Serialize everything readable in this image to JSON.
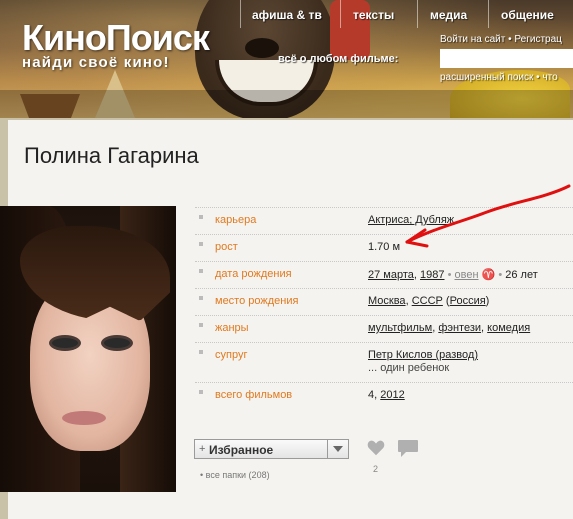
{
  "header": {
    "logo": "КиноПоиск",
    "tagline": "найди своё кино!",
    "nav": [
      "афиша & тв",
      "тексты",
      "медиа",
      "общение"
    ],
    "login_link": "Войти на сайт",
    "register_link": "Регистрац",
    "search_label": "всё о любом фильме:",
    "search_value": "",
    "advanced_search": "расширенный поиск",
    "more_link": "что"
  },
  "person": {
    "name": "Полина Гагарина",
    "fields": [
      {
        "label": "карьера",
        "value": "Актриса; Дубляж"
      },
      {
        "label": "рост",
        "value": "1.70 м"
      },
      {
        "label": "дата рождения",
        "date": "27 марта",
        "year": "1987",
        "sign": "овен",
        "age": "26 лет"
      },
      {
        "label": "место рождения",
        "city": "Москва",
        "country": "СССР",
        "country2": "Россия"
      },
      {
        "label": "жанры",
        "g1": "мультфильм",
        "g2": "фэнтези",
        "g3": "комедия"
      },
      {
        "label": "супруг",
        "value": "Петр Кислов (развод)",
        "sub": "... один ребенок"
      },
      {
        "label": "всего фильмов",
        "count": "4",
        "year": "2012"
      }
    ]
  },
  "actions": {
    "favorites_label": "Избранное",
    "folders": "все папки (208)",
    "likes": "2"
  },
  "colors": {
    "accent": "#e07a20",
    "annotation": "#e01010"
  }
}
